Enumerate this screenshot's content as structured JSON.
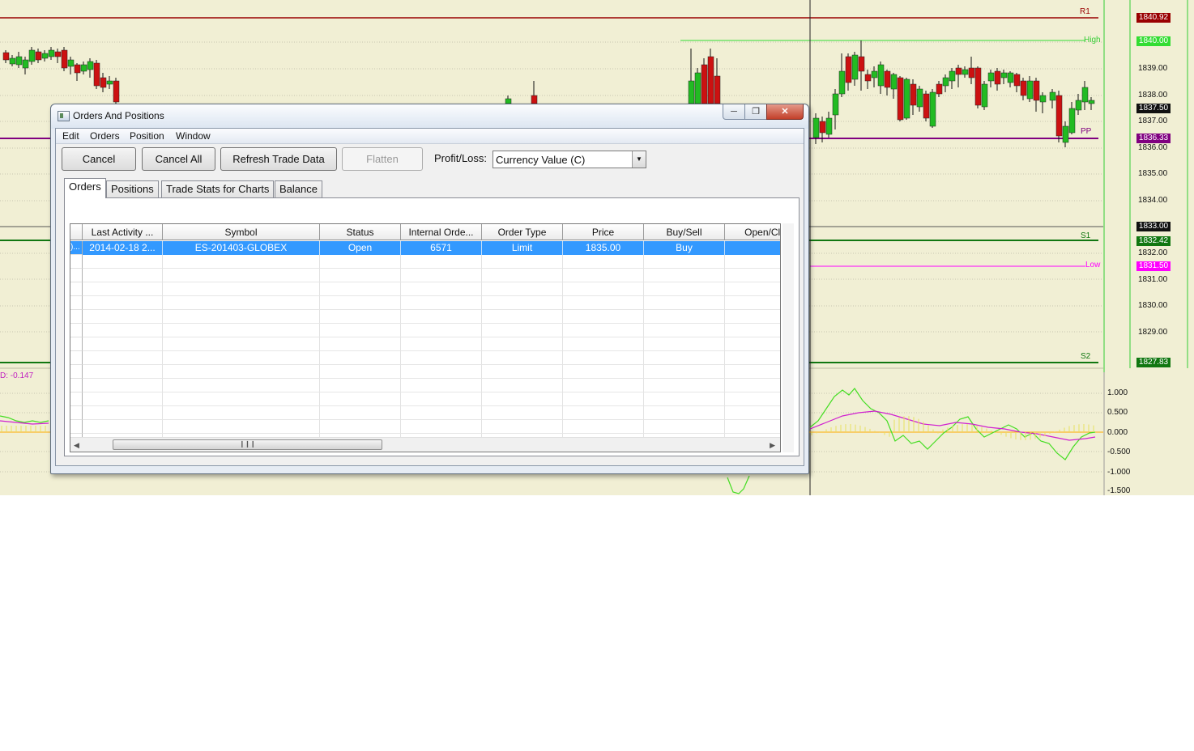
{
  "chart": {
    "price_axis_ticks": [
      "1839.00",
      "1838.00",
      "1837.00",
      "1836.00",
      "1835.00",
      "1834.00",
      "1832.00",
      "1831.00",
      "1830.00",
      "1829.00"
    ],
    "price_labels": {
      "r1": "1840.92",
      "high": "1840.00",
      "last": "1837.50",
      "pp": "1836.33",
      "current": "1833.00",
      "s1": "1832.42",
      "low": "1831.50",
      "s2": "1827.83"
    },
    "line_tags": {
      "r1": "R1",
      "high": "High",
      "pp": "PP",
      "s1": "S1",
      "low": "Low",
      "s2": "S2"
    },
    "oscillator_ticks": [
      "1.000",
      "0.500",
      "0.000",
      "-0.500",
      "-1.000",
      "-1.500"
    ],
    "oscillator_readout": "D: -0.147",
    "colors": {
      "background": "#f1efd4",
      "up_candle": "#22bb22",
      "down_candle": "#cc1111",
      "r1": "#990000",
      "high": "#33dd33",
      "pp": "#800080",
      "s1": "#117711",
      "low": "#ff00ff",
      "s2": "#117711"
    }
  },
  "window": {
    "title": "Orders And Positions",
    "icons": {
      "minimize": "minimize-icon",
      "maximize": "maximize-icon",
      "close": "close-icon"
    },
    "menu": [
      "Edit",
      "Orders",
      "Position",
      "Window"
    ],
    "toolbar": {
      "cancel": "Cancel",
      "cancel_all": "Cancel All",
      "refresh": "Refresh Trade Data",
      "flatten": "Flatten",
      "profit_loss_label": "Profit/Loss:",
      "profit_loss_value": "Currency Value (C)"
    },
    "tabs": [
      "Orders",
      "Positions",
      "Trade Stats for Charts",
      "Balance"
    ],
    "active_tab": "Orders",
    "table": {
      "columns": [
        "Last Activity ...",
        "Symbol",
        "Status",
        "Internal Orde...",
        "Order Type",
        "Price",
        "Buy/Sell",
        "Open/Clo"
      ],
      "rows": [
        {
          "handle": ")...",
          "last_activity": "2014-02-18  2...",
          "symbol": "ES-201403-GLOBEX",
          "status": "Open",
          "internal_order": "6571",
          "order_type": "Limit",
          "price": "1835.00",
          "buy_sell": "Buy",
          "open_close": ""
        }
      ]
    }
  }
}
